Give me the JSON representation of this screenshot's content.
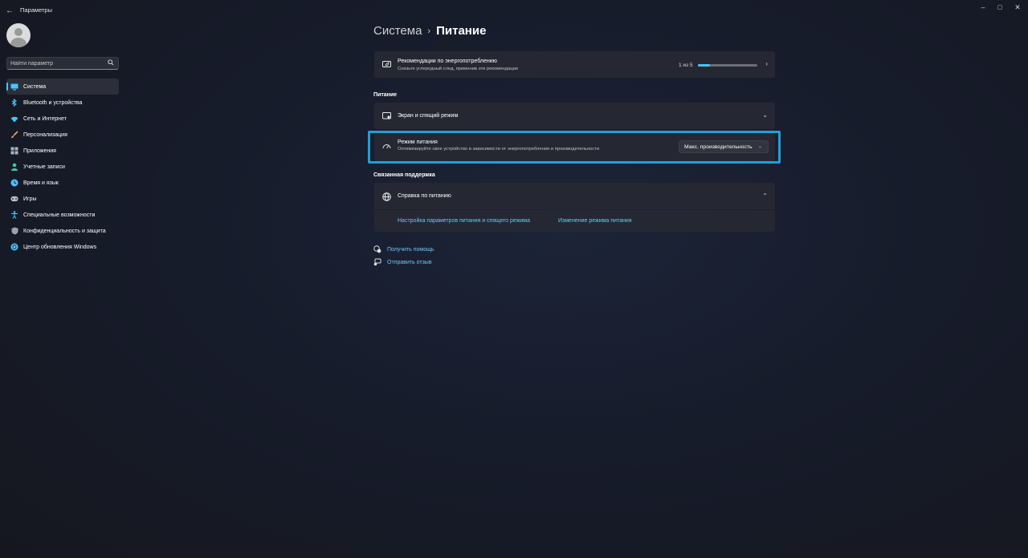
{
  "window": {
    "title": "Параметры",
    "controls": {
      "minimize": "–",
      "maximize": "▢",
      "close": "✕"
    }
  },
  "sidebar": {
    "search_placeholder": "Найти параметр",
    "items": [
      {
        "label": "Система",
        "icon": "monitor-icon",
        "color": "#4cc2ff",
        "active": true
      },
      {
        "label": "Bluetooth и устройства",
        "icon": "bluetooth-icon",
        "color": "#4cc2ff"
      },
      {
        "label": "Сеть и Интернет",
        "icon": "wifi-icon",
        "color": "#4cc2ff"
      },
      {
        "label": "Персонализация",
        "icon": "brush-icon",
        "color": "#f2a35e"
      },
      {
        "label": "Приложения",
        "icon": "apps-icon",
        "color": "#a6b4c8"
      },
      {
        "label": "Учетные записи",
        "icon": "person-icon",
        "color": "#3fc79a"
      },
      {
        "label": "Время и язык",
        "icon": "globe-clock-icon",
        "color": "#4cc2ff"
      },
      {
        "label": "Игры",
        "icon": "gamepad-icon",
        "color": "#b7c0cc"
      },
      {
        "label": "Специальные возможности",
        "icon": "accessibility-icon",
        "color": "#4cc2ff"
      },
      {
        "label": "Конфиденциальность и защита",
        "icon": "shield-icon",
        "color": "#9aa3ad"
      },
      {
        "label": "Центр обновления Windows",
        "icon": "update-icon",
        "color": "#4cc2ff"
      }
    ]
  },
  "breadcrumb": {
    "parent": "Система",
    "separator": "›",
    "current": "Питание"
  },
  "recommendations": {
    "title": "Рекомендации по энергопотреблению",
    "subtitle": "Снизьте углеродный след, применив эти рекомендации",
    "progress_text": "1 из 5",
    "progress_fraction": 0.2
  },
  "power_section": {
    "title": "Питание",
    "screen_sleep": {
      "title": "Экран и спящий режим"
    },
    "power_mode": {
      "title": "Режим питания",
      "subtitle": "Оптимизируйте свое устройство в зависимости от энергопотребления и производительности",
      "selected": "Макс. производительность"
    }
  },
  "related": {
    "title": "Связанная поддержка",
    "help": {
      "title": "Справка по питанию",
      "links": [
        "Настройка параметров питания и спящего режима",
        "Изменение режима питания"
      ]
    }
  },
  "footer": {
    "get_help": "Получить помощь",
    "feedback": "Отправить отзыв"
  },
  "colors": {
    "accent": "#4cc2ff",
    "link": "#6cc7f6",
    "highlight": "#1f9fd8",
    "card": "#252832"
  }
}
